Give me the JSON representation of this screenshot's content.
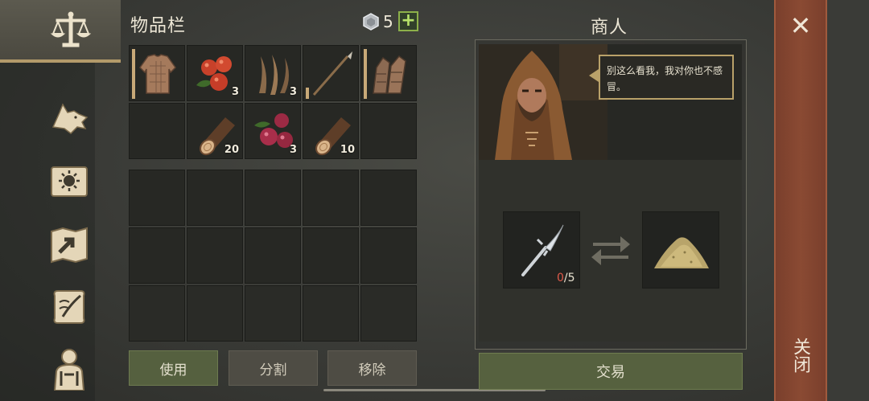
{
  "inventory": {
    "title": "物品栏",
    "currency": {
      "icon": "silver-coin-icon",
      "count": "5"
    },
    "add_label": "+",
    "slots": [
      {
        "icon": "cloth-tunic-icon",
        "qty": ""
      },
      {
        "icon": "red-berries-icon",
        "qty": "3"
      },
      {
        "icon": "fiber-stalks-icon",
        "qty": "3"
      },
      {
        "icon": "spear-icon",
        "qty": ""
      },
      {
        "icon": "leather-gloves-icon",
        "qty": ""
      },
      {
        "icon": "",
        "qty": ""
      },
      {
        "icon": "wood-log-icon",
        "qty": "20"
      },
      {
        "icon": "berry-bush-icon",
        "qty": "3"
      },
      {
        "icon": "wood-log-icon",
        "qty": "10"
      },
      {
        "icon": "",
        "qty": ""
      }
    ],
    "buttons": {
      "use": "使用",
      "split": "分割",
      "remove": "移除"
    }
  },
  "merchant": {
    "title": "商人",
    "speech": "别这么看我，我对你也不感冒。",
    "offer": {
      "icon": "bone-fork-icon",
      "have": "0",
      "need": "/5"
    },
    "receive": {
      "icon": "sawdust-pile-icon"
    },
    "trade_label": "交易"
  },
  "close": {
    "icon": "close-icon",
    "label": "关闭"
  },
  "nav": [
    "scales-icon",
    "wolf-icon",
    "sun-book-icon",
    "map-icon",
    "scroll-quill-icon",
    "character-icon"
  ]
}
